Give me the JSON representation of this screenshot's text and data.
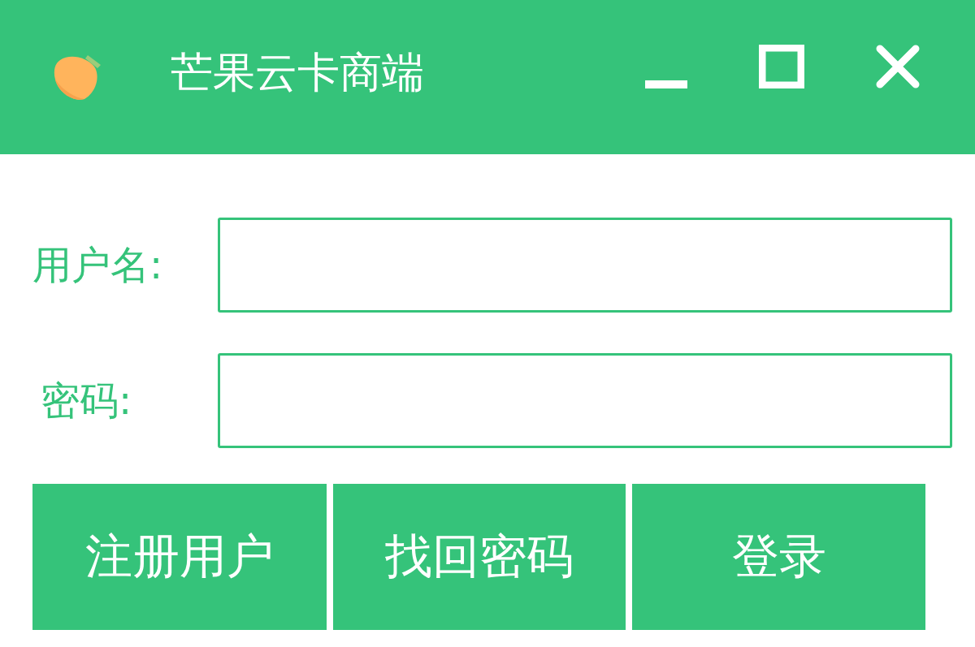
{
  "window": {
    "title": "芒果云卡商端"
  },
  "fields": [
    {
      "label": "用户名:"
    },
    {
      "label": "密码:"
    }
  ],
  "buttons": [
    {
      "label": "注册用户"
    },
    {
      "label": "找回密码"
    },
    {
      "label": "登录"
    }
  ]
}
